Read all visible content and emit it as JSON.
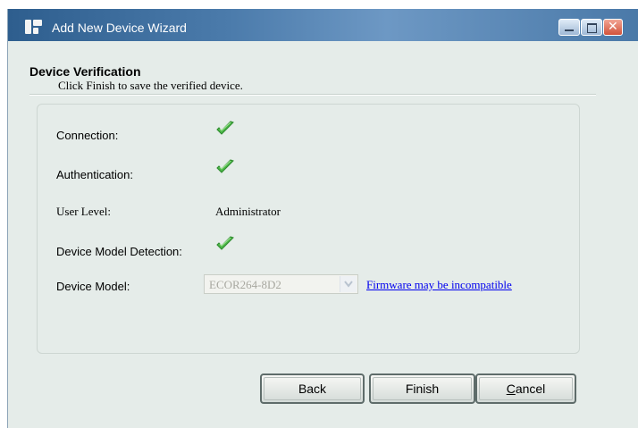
{
  "window": {
    "title": "Add New Device Wizard",
    "colors": {
      "titlebar": "#3b6b9c",
      "body": "#e5ece9",
      "check": "#4cb848",
      "link": "#0000ee"
    }
  },
  "header": {
    "title": "Device Verification",
    "subtitle": "Click Finish to save the verified device."
  },
  "fields": {
    "connection": {
      "label": "Connection:",
      "status_icon": "green-check-icon"
    },
    "authentication": {
      "label": "Authentication:",
      "status_icon": "green-check-icon"
    },
    "user_level": {
      "label": "User Level:",
      "value": "Administrator"
    },
    "model_detection": {
      "label": "Device Model Detection:",
      "status_icon": "green-check-icon"
    },
    "device_model": {
      "label": "Device Model:",
      "selected": "ECOR264-8D2",
      "enabled": false,
      "link": "Firmware may be incompatible"
    }
  },
  "buttons": {
    "back": "Back",
    "finish": "Finish",
    "cancel_first": "C",
    "cancel_rest": "ancel"
  }
}
